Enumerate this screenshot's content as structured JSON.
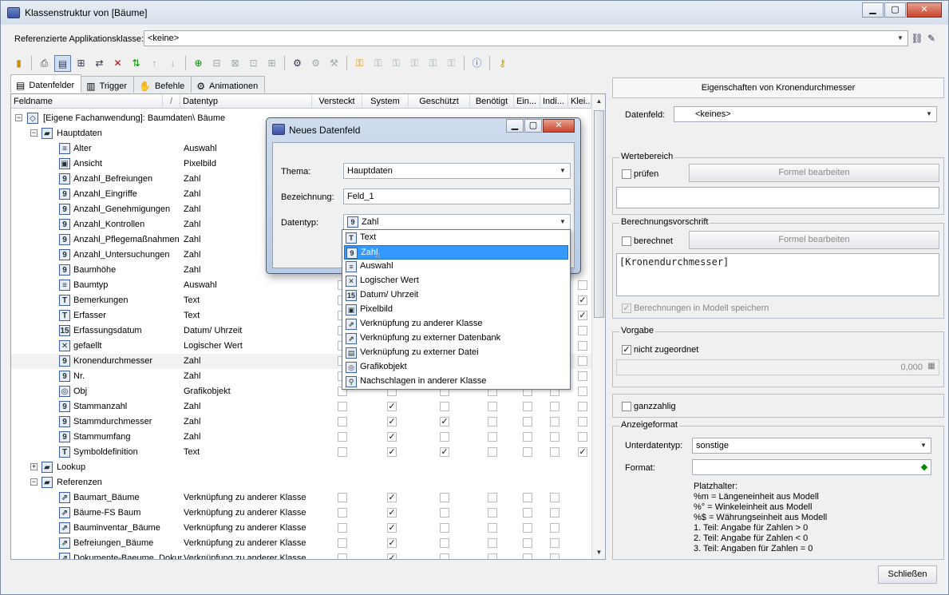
{
  "window": {
    "title": "Klassenstruktur von [Bäume]",
    "min": "▁",
    "max": "▢",
    "close": "✕"
  },
  "ref": {
    "label": "Referenzierte Applikationsklasse:",
    "value": "<keine>"
  },
  "tabs": [
    {
      "label": "Datenfelder",
      "icon": "fields-icon"
    },
    {
      "label": "Trigger",
      "icon": "trigger-icon"
    },
    {
      "label": "Befehle",
      "icon": "commands-icon"
    },
    {
      "label": "Animationen",
      "icon": "animations-icon"
    }
  ],
  "grid": {
    "headers": [
      "Feldname",
      "/",
      "Datentyp",
      "Versteckt",
      "System",
      "Geschützt",
      "Benötigt",
      "Ein...",
      "Indi...",
      "Klei..."
    ],
    "root": "[Eigene Fachanwendung]: Baumdaten\\ Bäume",
    "groups": [
      "Hauptdaten",
      "Lookup",
      "Referenzen"
    ],
    "rows": [
      {
        "name": "Alter",
        "type": "Auswahl",
        "icon": "≡",
        "c": [
          0,
          0,
          0,
          0,
          0,
          0,
          0
        ]
      },
      {
        "name": "Ansicht",
        "type": "Pixelbild",
        "icon": "▣",
        "c": [
          0,
          0,
          0,
          0,
          0,
          0,
          0
        ]
      },
      {
        "name": "Anzahl_Befreiungen",
        "type": "Zahl",
        "icon": "9",
        "c": [
          0,
          0,
          0,
          0,
          0,
          0,
          0
        ]
      },
      {
        "name": "Anzahl_Eingriffe",
        "type": "Zahl",
        "icon": "9",
        "c": [
          0,
          0,
          0,
          0,
          0,
          0,
          0
        ]
      },
      {
        "name": "Anzahl_Genehmigungen",
        "type": "Zahl",
        "icon": "9",
        "c": [
          0,
          0,
          0,
          0,
          0,
          0,
          0
        ]
      },
      {
        "name": "Anzahl_Kontrollen",
        "type": "Zahl",
        "icon": "9",
        "c": [
          0,
          0,
          0,
          0,
          0,
          0,
          0
        ]
      },
      {
        "name": "Anzahl_Pflegemaßnahmen",
        "type": "Zahl",
        "icon": "9",
        "c": [
          0,
          0,
          0,
          0,
          0,
          0,
          0
        ]
      },
      {
        "name": "Anzahl_Untersuchungen",
        "type": "Zahl",
        "icon": "9",
        "c": [
          0,
          0,
          0,
          0,
          0,
          0,
          0
        ]
      },
      {
        "name": "Baumhöhe",
        "type": "Zahl",
        "icon": "9",
        "c": [
          0,
          0,
          0,
          0,
          0,
          0,
          0
        ]
      },
      {
        "name": "Baumtyp",
        "type": "Auswahl",
        "icon": "≡",
        "c": [
          0,
          0,
          0,
          0,
          0,
          0,
          0
        ]
      },
      {
        "name": "Bemerkungen",
        "type": "Text",
        "icon": "T",
        "c": [
          0,
          0,
          0,
          0,
          0,
          0,
          1
        ]
      },
      {
        "name": "Erfasser",
        "type": "Text",
        "icon": "T",
        "c": [
          0,
          0,
          0,
          0,
          0,
          0,
          1
        ]
      },
      {
        "name": "Erfassungsdatum",
        "type": "Datum/ Uhrzeit",
        "icon": "15",
        "c": [
          0,
          0,
          0,
          0,
          0,
          0,
          0
        ]
      },
      {
        "name": "gefaellt",
        "type": "Logischer Wert",
        "icon": "✕",
        "c": [
          0,
          0,
          0,
          0,
          0,
          0,
          0
        ]
      },
      {
        "name": "Kronendurchmesser",
        "type": "Zahl",
        "icon": "9",
        "c": [
          0,
          0,
          0,
          0,
          0,
          0,
          0
        ]
      },
      {
        "name": "Nr.",
        "type": "Zahl",
        "icon": "9",
        "c": [
          0,
          0,
          0,
          0,
          0,
          0,
          0
        ]
      },
      {
        "name": "Obj",
        "type": "Grafikobjekt",
        "icon": "◎",
        "c": [
          0,
          0,
          0,
          0,
          0,
          0,
          0
        ]
      },
      {
        "name": "Stammanzahl",
        "type": "Zahl",
        "icon": "9",
        "c": [
          0,
          1,
          0,
          0,
          0,
          0,
          0
        ]
      },
      {
        "name": "Stammdurchmesser",
        "type": "Zahl",
        "icon": "9",
        "c": [
          0,
          1,
          1,
          0,
          0,
          0,
          0
        ]
      },
      {
        "name": "Stammumfang",
        "type": "Zahl",
        "icon": "9",
        "c": [
          0,
          1,
          0,
          0,
          0,
          0,
          0
        ]
      },
      {
        "name": "Symboldefinition",
        "type": "Text",
        "icon": "T",
        "c": [
          0,
          1,
          1,
          0,
          0,
          0,
          1
        ]
      }
    ],
    "refrows": [
      {
        "name": "Baumart_Bäume",
        "type": "Verknüpfung zu anderer Klasse",
        "c": [
          0,
          1,
          0,
          0,
          0,
          0
        ]
      },
      {
        "name": "Bäume-FS Baum",
        "type": "Verknüpfung zu anderer Klasse",
        "c": [
          0,
          1,
          0,
          0,
          0,
          0
        ]
      },
      {
        "name": "Bauminventar_Bäume",
        "type": "Verknüpfung zu anderer Klasse",
        "c": [
          0,
          1,
          0,
          0,
          0,
          0
        ]
      },
      {
        "name": "Befreiungen_Bäume",
        "type": "Verknüpfung zu anderer Klasse",
        "c": [
          0,
          1,
          0,
          0,
          0,
          0
        ]
      },
      {
        "name": "Dokumente-Baeume_Dokur",
        "type": "Verknüpfung zu anderer Klasse",
        "c": [
          0,
          1,
          0,
          0,
          0,
          0
        ]
      }
    ]
  },
  "props": {
    "title": "Eigenschaften von Kronendurchmesser",
    "datenfeld_label": "Datenfeld:",
    "datenfeld_value": "<keines>",
    "wertebereich": "Wertebereich",
    "pruefen": "prüfen",
    "formel_btn": "Formel bearbeiten",
    "berechnung": "Berechnungsvorschrift",
    "berechnet": "berechnet",
    "formula_text": "[Kronendurchmesser]",
    "speichern": "Berechnungen in Modell speichern",
    "vorgabe": "Vorgabe",
    "nicht_zugeordnet": "nicht zugeordnet",
    "vorgabe_value": "0,000",
    "ganzzahlig": "ganzzahlig",
    "anzeigeformat": "Anzeigeformat",
    "unterdatentyp_label": "Unterdatentyp:",
    "unterdatentyp_value": "sonstige",
    "format_label": "Format:",
    "platzhalter": [
      "Platzhalter:",
      "%m = Längeneinheit aus Modell",
      "%° = Winkeleinheit aus Modell",
      "%$ = Währungseinheit aus Modell",
      "1. Teil: Angabe für Zahlen > 0",
      "2. Teil: Angabe für Zahlen < 0",
      "3. Teil: Angaben für Zahlen = 0"
    ]
  },
  "dialog": {
    "title": "Neues Datenfeld",
    "thema_label": "Thema:",
    "thema_value": "Hauptdaten",
    "bez_label": "Bezeichnung:",
    "bez_value": "Feld_1",
    "typ_label": "Datentyp:",
    "typ_value": "Zahl",
    "options": [
      {
        "label": "Text",
        "icon": "T"
      },
      {
        "label": "Zahl",
        "icon": "9"
      },
      {
        "label": "Auswahl",
        "icon": "≡"
      },
      {
        "label": "Logischer Wert",
        "icon": "✕"
      },
      {
        "label": "Datum/ Uhrzeit",
        "icon": "15"
      },
      {
        "label": "Pixelbild",
        "icon": "▣"
      },
      {
        "label": "Verknüpfung zu anderer Klasse",
        "icon": "⇗"
      },
      {
        "label": "Verknüpfung zu externer Datenbank",
        "icon": "⇗"
      },
      {
        "label": "Verknüpfung zu externer Datei",
        "icon": "▤"
      },
      {
        "label": "Grafikobjekt",
        "icon": "◎"
      },
      {
        "label": "Nachschlagen in anderer Klasse",
        "icon": "⚲"
      }
    ]
  },
  "footer": {
    "close": "Schließen"
  }
}
